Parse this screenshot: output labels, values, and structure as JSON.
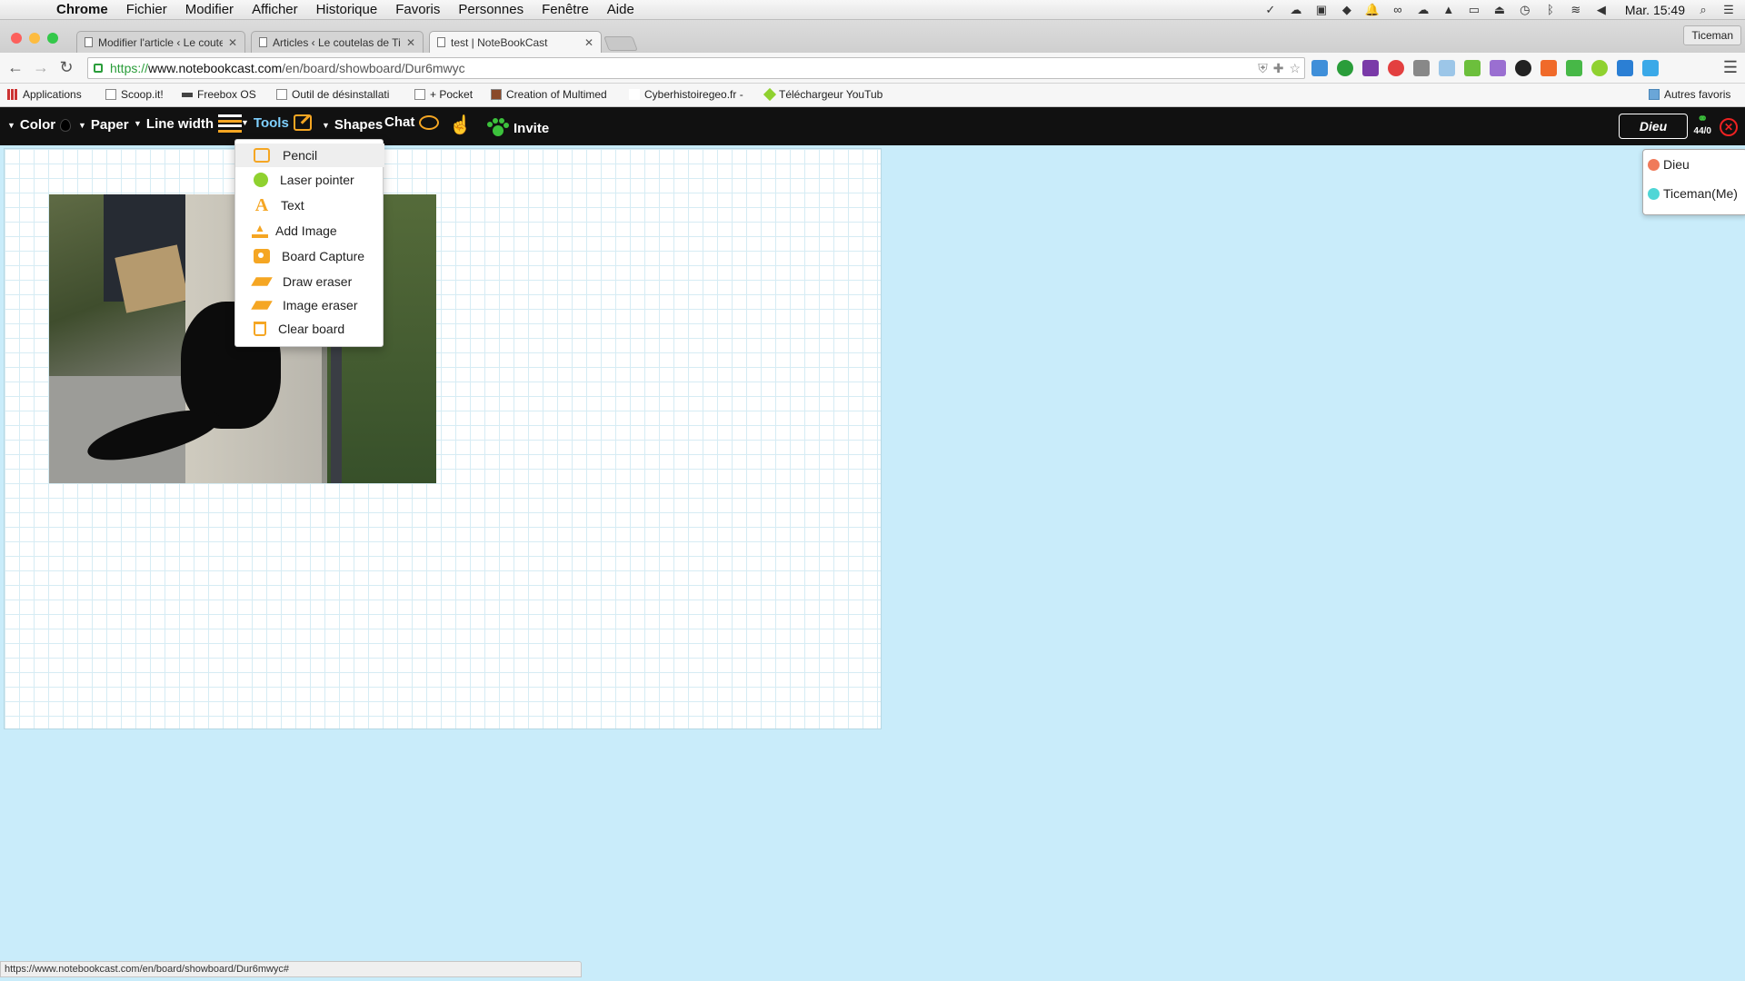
{
  "menubar": {
    "apple": "",
    "items": [
      "Chrome",
      "Fichier",
      "Modifier",
      "Afficher",
      "Historique",
      "Favoris",
      "Personnes",
      "Fenêtre",
      "Aide"
    ],
    "clock": "Mar. 15:49"
  },
  "tabs": [
    {
      "title": "Modifier l'article ‹ Le coutel",
      "active": false
    },
    {
      "title": "Articles ‹ Le coutelas de Ti",
      "active": false
    },
    {
      "title": "test | NoteBookCast",
      "active": true
    }
  ],
  "profile": "Ticeman",
  "omnibox": {
    "scheme": "https://",
    "host": "www.notebookcast.com",
    "path": "/en/board/showboard/Dur6mwyc"
  },
  "bookmarks": [
    {
      "label": "Applications",
      "icon": "apps-grid-icon"
    },
    {
      "label": "Scoop.it!",
      "icon": "page-icon"
    },
    {
      "label": "Freebox OS",
      "icon": "freebox-icon"
    },
    {
      "label": "Outil de désinstallati",
      "icon": "tool-icon"
    },
    {
      "label": "+ Pocket",
      "icon": "page-icon"
    },
    {
      "label": "Creation of Multimed",
      "icon": "image-icon"
    },
    {
      "label": "Cyberhistoiregeo.fr -",
      "icon": "glasses-icon"
    },
    {
      "label": "Téléchargeur YouTub",
      "icon": "download-icon"
    },
    {
      "label": "Autres favoris",
      "icon": "folder-icon"
    }
  ],
  "appbar": {
    "color": "Color",
    "paper": "Paper",
    "line_width": "Line width",
    "tools": "Tools",
    "shapes": "Shapes",
    "chat": "Chat",
    "invite": "Invite",
    "user": "Dieu",
    "connection": "44/0",
    "accent": "#f5a623"
  },
  "tools_menu": [
    {
      "label": "Pencil",
      "icon": "pencil-icon",
      "highlighted": true
    },
    {
      "label": "Laser pointer",
      "icon": "laser-pointer-icon",
      "highlighted": false
    },
    {
      "label": "Text",
      "icon": "text-icon",
      "highlighted": false
    },
    {
      "label": "Add Image",
      "icon": "upload-icon",
      "highlighted": false
    },
    {
      "label": "Board Capture",
      "icon": "camera-icon",
      "highlighted": false
    },
    {
      "label": "Draw eraser",
      "icon": "eraser-icon",
      "highlighted": false
    },
    {
      "label": "Image eraser",
      "icon": "eraser-icon",
      "highlighted": false
    },
    {
      "label": "Clear board",
      "icon": "trash-icon",
      "highlighted": false
    }
  ],
  "users": [
    {
      "name": "Dieu",
      "color": "#f07a5a"
    },
    {
      "name": "Ticeman(Me)",
      "color": "#4fd6d6"
    }
  ],
  "status_url": "https://www.notebookcast.com/en/board/showboard/Dur6mwyc#"
}
